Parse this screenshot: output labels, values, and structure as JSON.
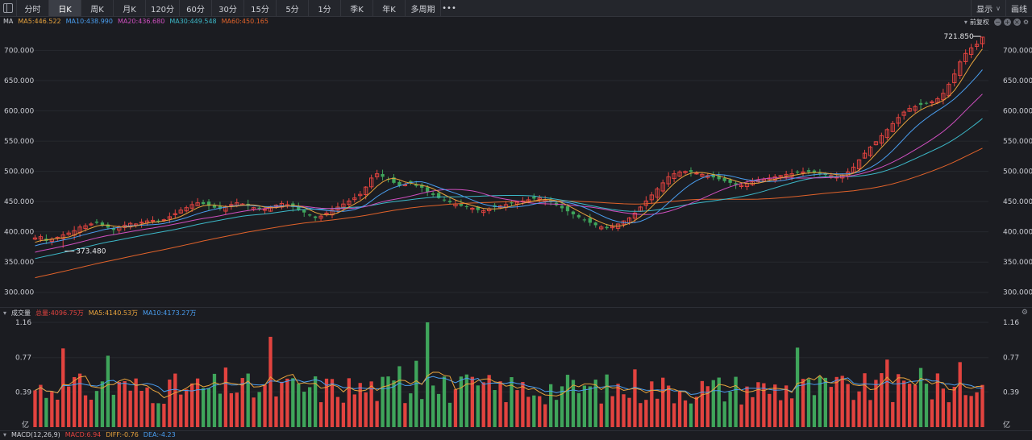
{
  "toolbar": {
    "tabs": [
      "分时",
      "日K",
      "周K",
      "月K",
      "120分",
      "60分",
      "30分",
      "15分",
      "5分",
      "1分",
      "季K",
      "年K",
      "多周期"
    ],
    "active_tab": "日K",
    "more_label": "•••",
    "display_label": "显示",
    "draw_label": "画线"
  },
  "price_panel": {
    "legend_title": "MA",
    "ma5": "MA5:446.522",
    "ma10": "MA10:438.990",
    "ma20": "MA20:436.680",
    "ma30": "MA30:449.548",
    "ma60": "MA60:450.165",
    "adjust_label": "前复权",
    "y_ticks": [
      "700.000",
      "650.000",
      "600.000",
      "550.000",
      "500.000",
      "450.000",
      "400.000",
      "350.000",
      "300.000"
    ],
    "high_label": "721.850",
    "low_label": "373.480"
  },
  "volume_panel": {
    "title": "成交量",
    "total": "总量:4096.75万",
    "ma5": "MA5:4140.53万",
    "ma10": "MA10:4173.27万",
    "y_ticks": [
      "1.16",
      "0.77",
      "0.39"
    ],
    "unit": "亿"
  },
  "macd_panel": {
    "title": "MACD(12,26,9)",
    "macd": "MACD:6.94",
    "diff": "DIFF:-0.76",
    "dea": "DEA:-4.23"
  },
  "colors": {
    "up": "#e2433f",
    "down": "#3fa55b",
    "ma5": "#e8a33d",
    "ma10": "#4a9ef0",
    "ma20": "#d04fc0",
    "ma30": "#3cb8c8",
    "ma60": "#e0622a"
  },
  "chart_data": {
    "type": "candlestick",
    "y_range": [
      285,
      730
    ],
    "closes": [
      390,
      392,
      385,
      388,
      391,
      395,
      398,
      402,
      408,
      410,
      413,
      415,
      410,
      407,
      403,
      408,
      411,
      414,
      413,
      416,
      418,
      419,
      417,
      420,
      425,
      430,
      436,
      440,
      445,
      448,
      446,
      443,
      440,
      438,
      442,
      445,
      448,
      446,
      443,
      440,
      438,
      437,
      441,
      444,
      447,
      445,
      441,
      437,
      432,
      427,
      423,
      426,
      431,
      436,
      441,
      446,
      451,
      456,
      462,
      474,
      489,
      496,
      491,
      486,
      481,
      476,
      478,
      481,
      476,
      473,
      466,
      461,
      456,
      452,
      449,
      446,
      443,
      441,
      439,
      436,
      435,
      438,
      441,
      443,
      445,
      447,
      449,
      451,
      453,
      455,
      456,
      453,
      449,
      444,
      439,
      434,
      429,
      424,
      419,
      415,
      411,
      408,
      406,
      409,
      413,
      418,
      423,
      431,
      441,
      451,
      461,
      471,
      481,
      491,
      496,
      499,
      500,
      499,
      497,
      495,
      493,
      490,
      487,
      484,
      481,
      478,
      477,
      480,
      483,
      485,
      487,
      489,
      491,
      493,
      495,
      496,
      498,
      499,
      499,
      498,
      496,
      494,
      493,
      491,
      494,
      499,
      507,
      519,
      530,
      540,
      549,
      559,
      569,
      579,
      589,
      598,
      604,
      607,
      610,
      612,
      615,
      620,
      629,
      644,
      661,
      681,
      695,
      704,
      710,
      722
    ],
    "volume_x_ticks": [
      "1.16",
      "0.77",
      "0.39"
    ]
  }
}
